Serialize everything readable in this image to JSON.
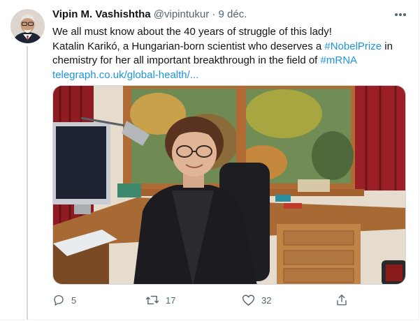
{
  "tweet": {
    "author_name": "Vipin M. Vashishtha",
    "handle": "@vipintukur",
    "separator": "·",
    "date": "9 déc.",
    "body": {
      "line1": "We all must know about the 40 years of struggle of this lady!",
      "line2_a": "Katalin Karikó, a Hungarian-born scientist who deserves a ",
      "hashtag_nobel": "#NobelPrize",
      "line2_b": " in",
      "line3_a": "chemistry for her all important breakthrough in the field of ",
      "hashtag_mrna": "#mRNA",
      "link": "telegraph.co.uk/global-health/..."
    },
    "actions": {
      "reply_count": "5",
      "retweet_count": "17",
      "like_count": "32"
    }
  },
  "colors": {
    "link": "#1b95e0",
    "secondary_text": "#536471",
    "thread_line": "#cfd9de"
  },
  "icons": [
    "avatar-photo",
    "more-icon",
    "reply-icon",
    "retweet-icon",
    "like-icon",
    "share-icon"
  ]
}
